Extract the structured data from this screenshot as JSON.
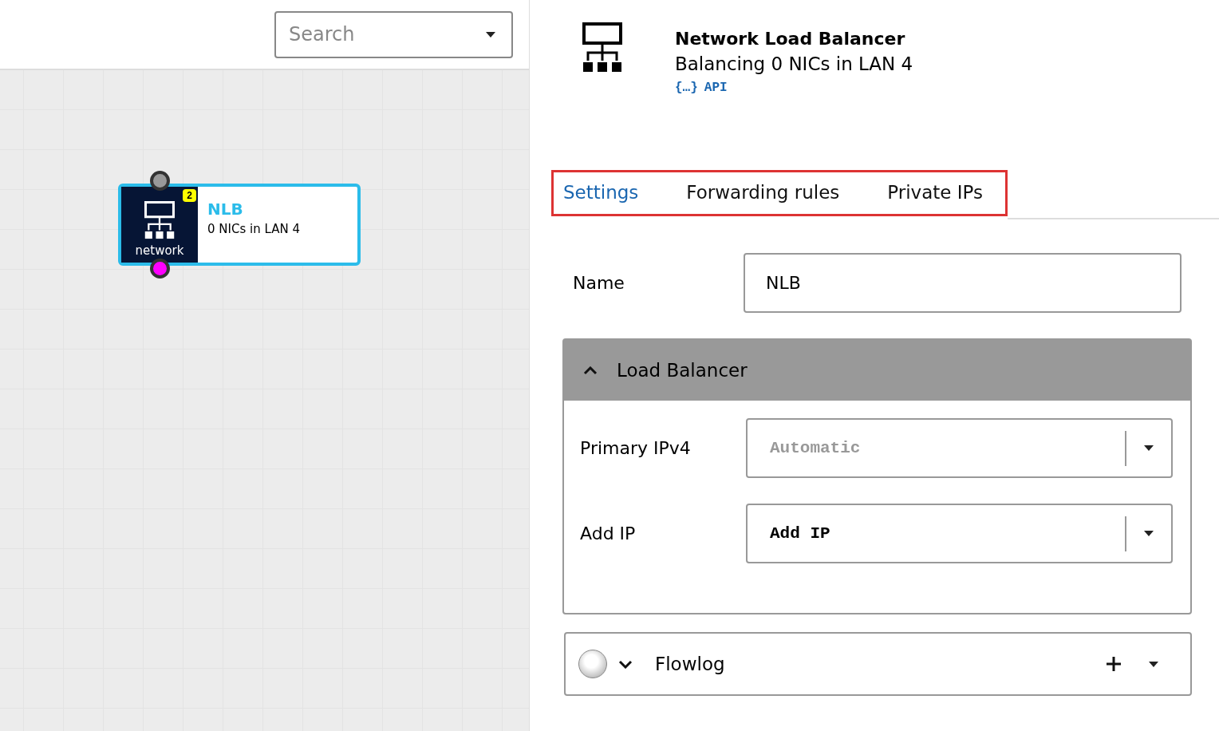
{
  "search": {
    "placeholder": "Search"
  },
  "canvas": {
    "node": {
      "title": "NLB",
      "subtitle": "0 NICs in LAN 4",
      "type_label": "network",
      "badge": "2",
      "selected": true
    }
  },
  "header": {
    "title": "Network Load Balancer",
    "subtitle": "Balancing 0 NICs in LAN 4",
    "api_icon": "{…}",
    "api_label": "API"
  },
  "tabs": [
    {
      "label": "Settings",
      "selected": true
    },
    {
      "label": "Forwarding rules",
      "selected": false
    },
    {
      "label": "Private IPs",
      "selected": false
    }
  ],
  "name_field": {
    "label": "Name",
    "value": "NLB"
  },
  "load_balancer": {
    "title": "Load Balancer",
    "expanded": true,
    "fields": [
      {
        "label": "Primary IPv4",
        "placeholder": "Automatic"
      },
      {
        "label": "Add IP",
        "value": "Add IP"
      }
    ]
  },
  "flowlog": {
    "title": "Flowlog",
    "expanded": false
  }
}
